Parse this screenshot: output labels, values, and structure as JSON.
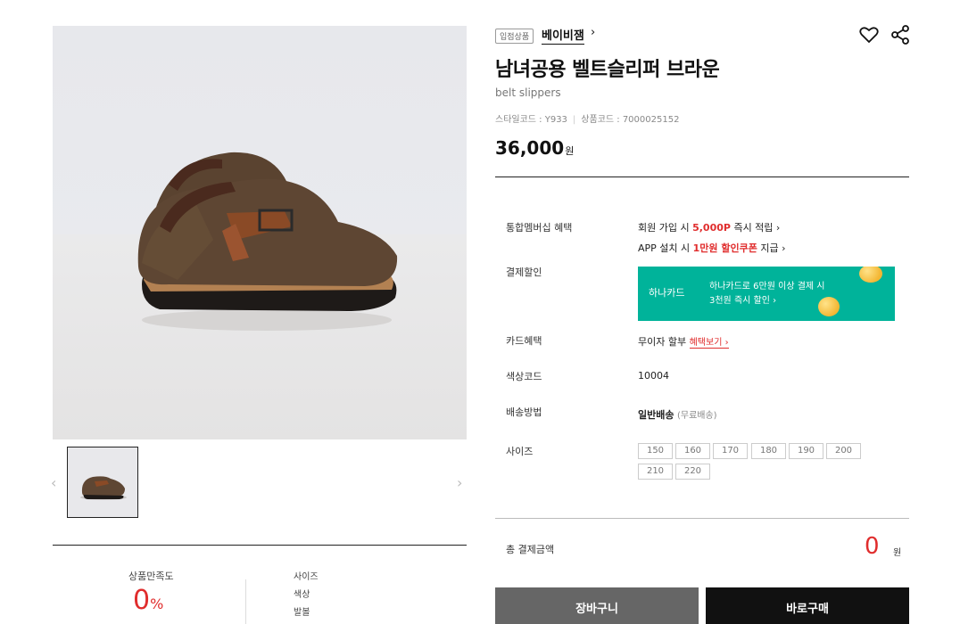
{
  "product": {
    "badge": "입점상품",
    "brand": "베이비잼",
    "brand_chevron": "›",
    "title": "남녀공용 벨트슬리퍼 브라운",
    "subtitle": "belt slippers",
    "style_code": "스타일코드 : Y933",
    "product_code": "상품코드 : 7000025152",
    "price": "36,000",
    "price_unit": "원"
  },
  "gallery": {
    "prev_arrow": "‹",
    "next_arrow": "›"
  },
  "review": {
    "satisfaction_label": "상품만족도",
    "satisfaction_value": "0",
    "satisfaction_unit": "%",
    "items": [
      "사이즈",
      "색상",
      "발볼"
    ]
  },
  "benefits": {
    "membership_label": "통합멤버십 혜택",
    "membership_line1_pre": "회원 가입 시 ",
    "membership_line1_hl": "5,000P",
    "membership_line1_post": " 즉시 적립 ›",
    "membership_line2_pre": "APP 설치 시 ",
    "membership_line2_hl": "1만원 할인쿠폰",
    "membership_line2_post": " 지급 ›",
    "payment_label": "결제할인",
    "banner_logo": "하나카드",
    "banner_line1": "하나카드로 6만원 이상 결제 시",
    "banner_line2": "3천원 즉시 할인 ›",
    "card_label": "카드혜택",
    "card_value": "무이자 할부",
    "card_link": "혜택보기 ›",
    "color_label": "색상코드",
    "color_value": "10004",
    "shipping_label": "배송방법",
    "shipping_value": "일반배송",
    "shipping_note": "(무료배송)",
    "size_label": "사이즈",
    "sizes": [
      "150",
      "160",
      "170",
      "180",
      "190",
      "200",
      "210",
      "220"
    ]
  },
  "total": {
    "label": "총 결제금액",
    "value": "0",
    "unit": "원"
  },
  "buttons": {
    "cart": "장바구니",
    "buy": "바로구매"
  },
  "colors": {
    "accent_red": "#e02d2d",
    "banner_teal": "#00b39a",
    "cart_btn": "#666666",
    "buy_btn": "#111111"
  },
  "icons": {
    "wishlist": "heart-icon",
    "share": "share-icon"
  }
}
